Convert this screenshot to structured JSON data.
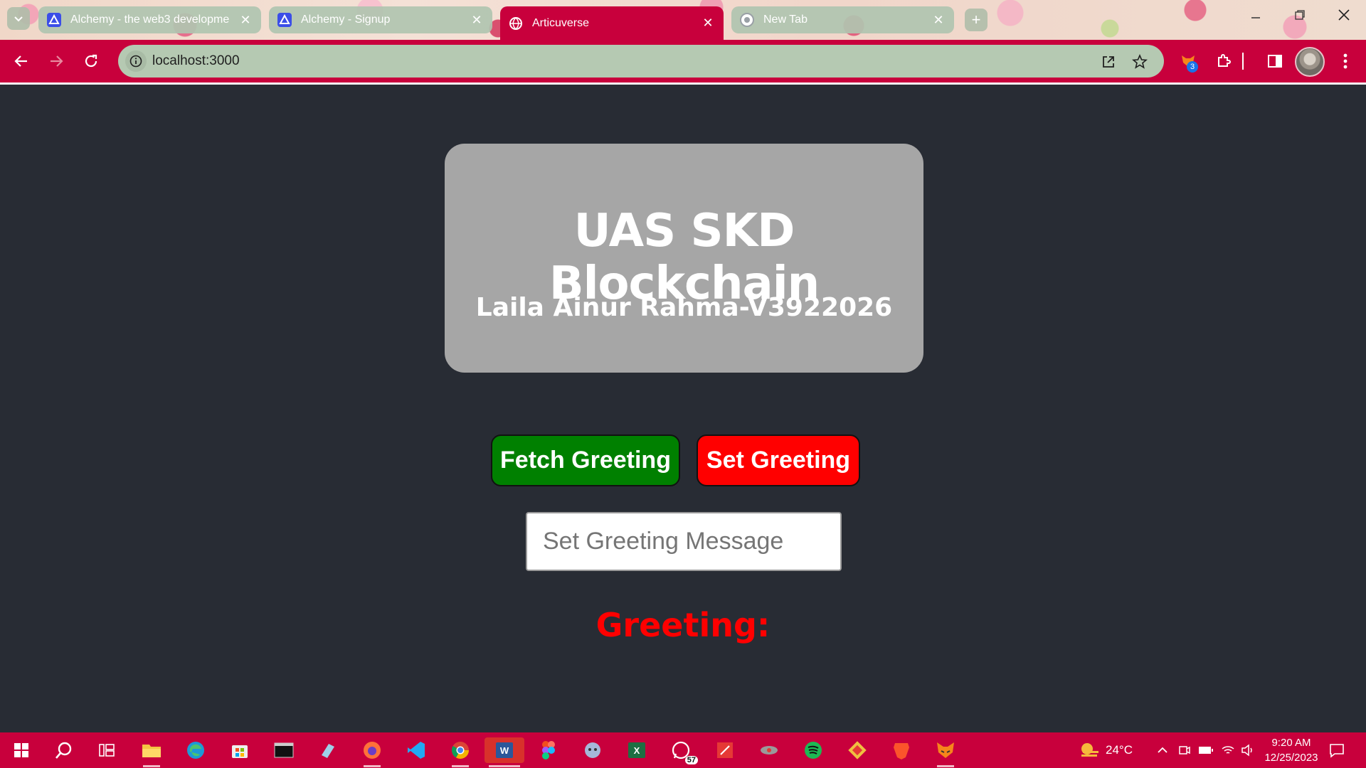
{
  "browser": {
    "tabs": [
      {
        "title": "Alchemy - the web3 developme",
        "favicon": "alchemy-logo-icon",
        "active": false
      },
      {
        "title": "Alchemy - Signup",
        "favicon": "alchemy-logo-icon",
        "active": false
      },
      {
        "title": "Articuverse",
        "favicon": "globe-icon",
        "active": true
      },
      {
        "title": "New Tab",
        "favicon": "chrome-icon",
        "active": false
      }
    ],
    "close_glyph": "✕",
    "new_tab_glyph": "+",
    "url": "localhost:3000",
    "extension_badge": "3",
    "colors": {
      "theme": "#c8003c",
      "tab_inactive": "#b0c4b0"
    }
  },
  "page": {
    "card": {
      "title": "UAS SKD Blockchain",
      "subtitle": "Laila Ainur Rahma-V3922026"
    },
    "fetch_button": "Fetch Greeting",
    "set_button": "Set Greeting",
    "input": {
      "placeholder": "Set Greeting Message",
      "value": ""
    },
    "greeting_label": "Greeting:",
    "colors": {
      "background": "#282c34",
      "card": "#a6a6a6",
      "fetch": "#008000",
      "set": "#ff0000",
      "greeting": "#ff0000"
    }
  },
  "taskbar": {
    "apps": [
      "start-icon",
      "search-icon",
      "task-view-icon",
      "file-explorer-icon",
      "edge-icon",
      "microsoft-store-icon",
      "terminal-icon",
      "notes-icon",
      "firefox-icon",
      "vscode-icon",
      "chrome-icon",
      "word-icon",
      "figma-icon",
      "github-desktop-icon",
      "excel-icon",
      "whatsapp-icon",
      "pdf-editor-icon",
      "app-icon",
      "spotify-icon",
      "git-icon",
      "brave-icon",
      "metamask-icon"
    ],
    "whatsapp_badge": "57",
    "weather": "24°C",
    "time": "9:20 AM",
    "date": "12/25/2023"
  }
}
